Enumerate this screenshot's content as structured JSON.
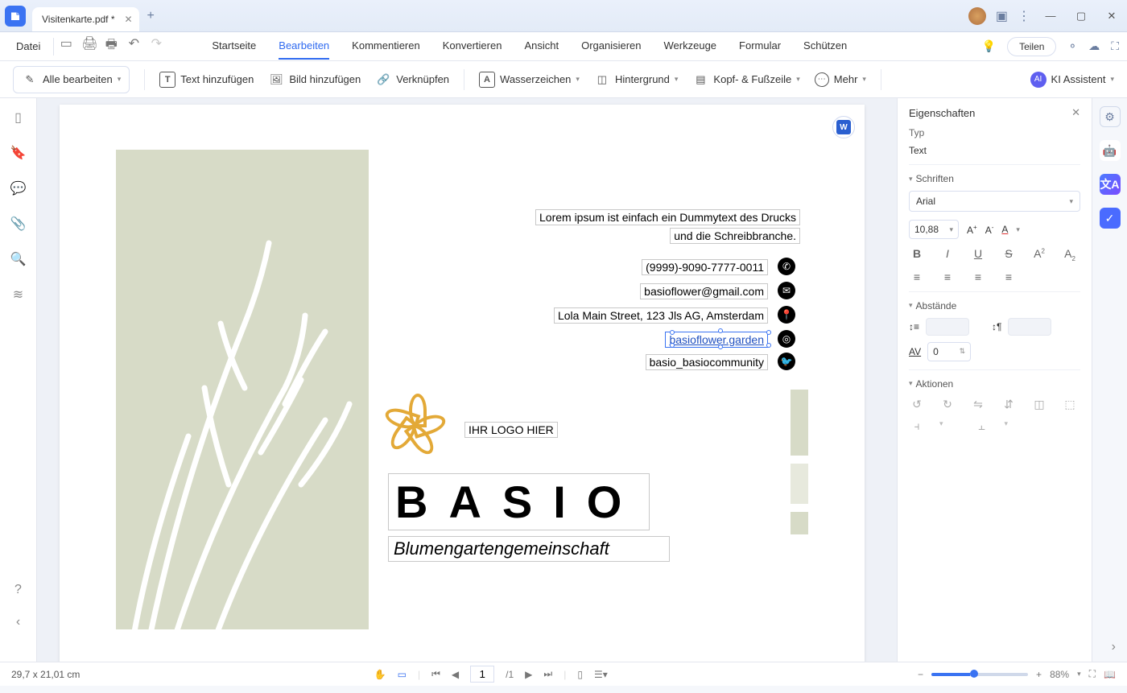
{
  "tab": {
    "title": "Visitenkarte.pdf *"
  },
  "menubar": {
    "file": "Datei"
  },
  "mainMenu": {
    "start": "Startseite",
    "edit": "Bearbeiten",
    "comment": "Kommentieren",
    "convert": "Konvertieren",
    "view": "Ansicht",
    "organize": "Organisieren",
    "tools": "Werkzeuge",
    "form": "Formular",
    "protect": "Schützen",
    "share": "Teilen"
  },
  "toolbar": {
    "editAll": "Alle bearbeiten",
    "addText": "Text hinzufügen",
    "addImage": "Bild hinzufügen",
    "link": "Verknüpfen",
    "watermark": "Wasserzeichen",
    "background": "Hintergrund",
    "headerFooter": "Kopf- & Fußzeile",
    "more": "Mehr",
    "aiAssistant": "KI Assistent"
  },
  "card": {
    "lorem1": "Lorem ipsum ist einfach ein Dummytext des Drucks",
    "lorem2": "und die Schreibbranche.",
    "phone": "(9999)-9090-7777-0011",
    "email": "basioflower@gmail.com",
    "address": "Lola Main Street, 123 Jls AG, Amsterdam",
    "instagram": "basioflower.garden",
    "twitter": "basio_basiocommunity",
    "logoHere": "IHR LOGO HIER",
    "brand": "BASIO",
    "subtitle": "Blumengartengemeinschaft"
  },
  "props": {
    "title": "Eigenschaften",
    "typeLabel": "Typ",
    "typeValue": "Text",
    "fontsLabel": "Schriften",
    "fontName": "Arial",
    "fontSize": "10,88",
    "spacingLabel": "Abstände",
    "charSpacing": "0",
    "actionsLabel": "Aktionen"
  },
  "status": {
    "dims": "29,7 x 21,01 cm",
    "page": "1",
    "pageTotal": "/1",
    "zoom": "88%"
  }
}
